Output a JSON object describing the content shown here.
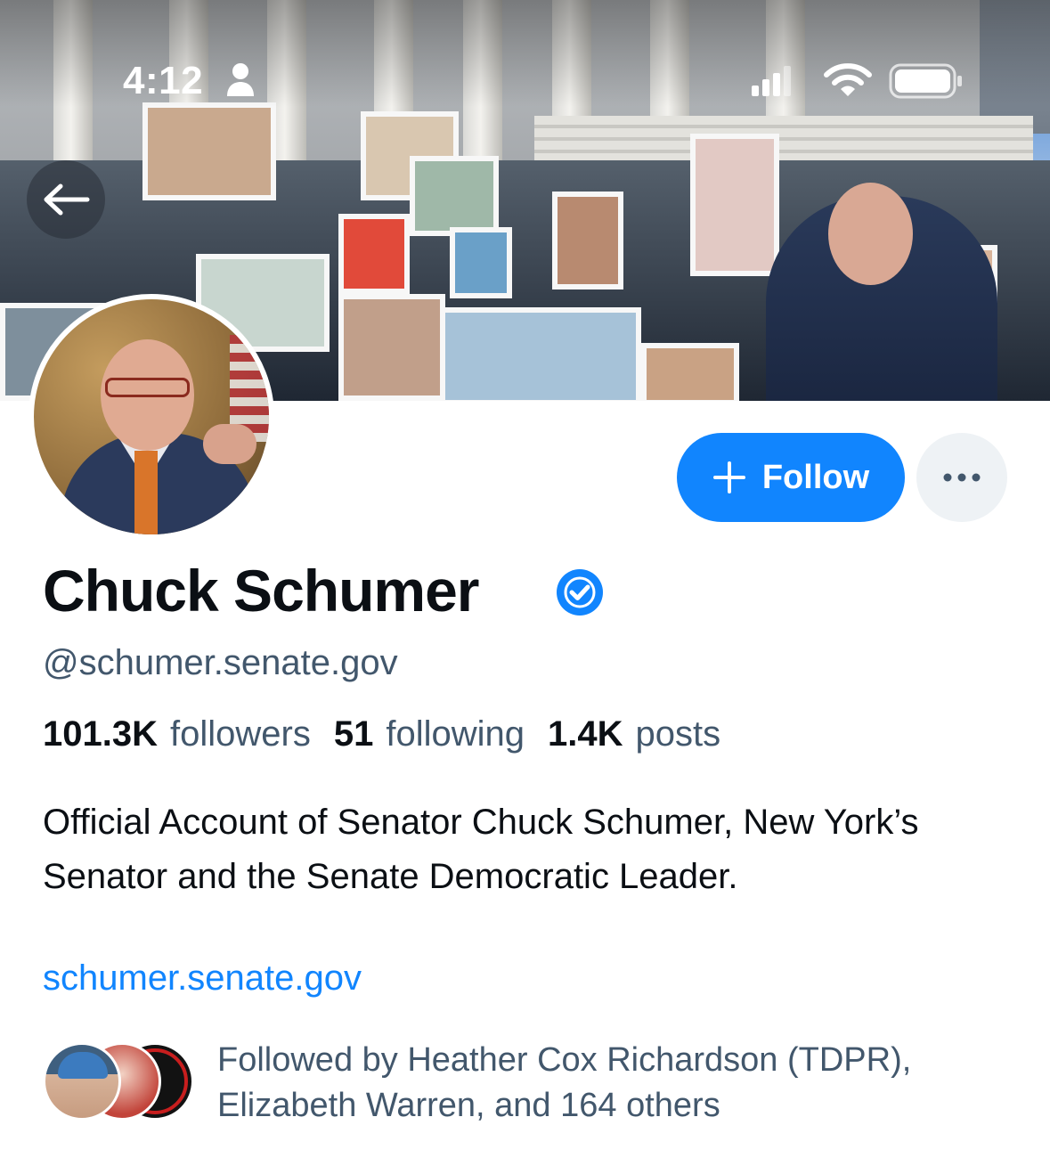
{
  "status_bar": {
    "time": "4:12",
    "icons": [
      "person-icon",
      "signal-icon",
      "wifi-icon",
      "battery-icon"
    ]
  },
  "header": {
    "back_icon": "back-arrow-icon",
    "banner_image": "capitol-steps-photo",
    "avatar_image": "profile-photo"
  },
  "actions": {
    "follow_icon": "plus-icon",
    "follow_label": "Follow",
    "more_icon": "ellipsis-icon"
  },
  "profile": {
    "display_name": "Chuck Schumer",
    "verified_icon": "verified-check-icon",
    "handle": "@schumer.senate.gov",
    "stats": {
      "followers_count": "101.3K",
      "followers_label": "followers",
      "following_count": "51",
      "following_label": "following",
      "posts_count": "1.4K",
      "posts_label": "posts"
    },
    "bio": "Official Account of Senator Chuck Schumer, New York’s Senator and the Senate Democratic Leader.",
    "website": "schumer.senate.gov",
    "followed_by": "Followed by Heather Cox Richardson (TDPR), Elizabeth Warren, and 164 others"
  },
  "colors": {
    "accent": "#1185fe",
    "text_primary": "#0b0f14",
    "text_secondary": "#42576c",
    "button_secondary_bg": "#eef2f5"
  }
}
